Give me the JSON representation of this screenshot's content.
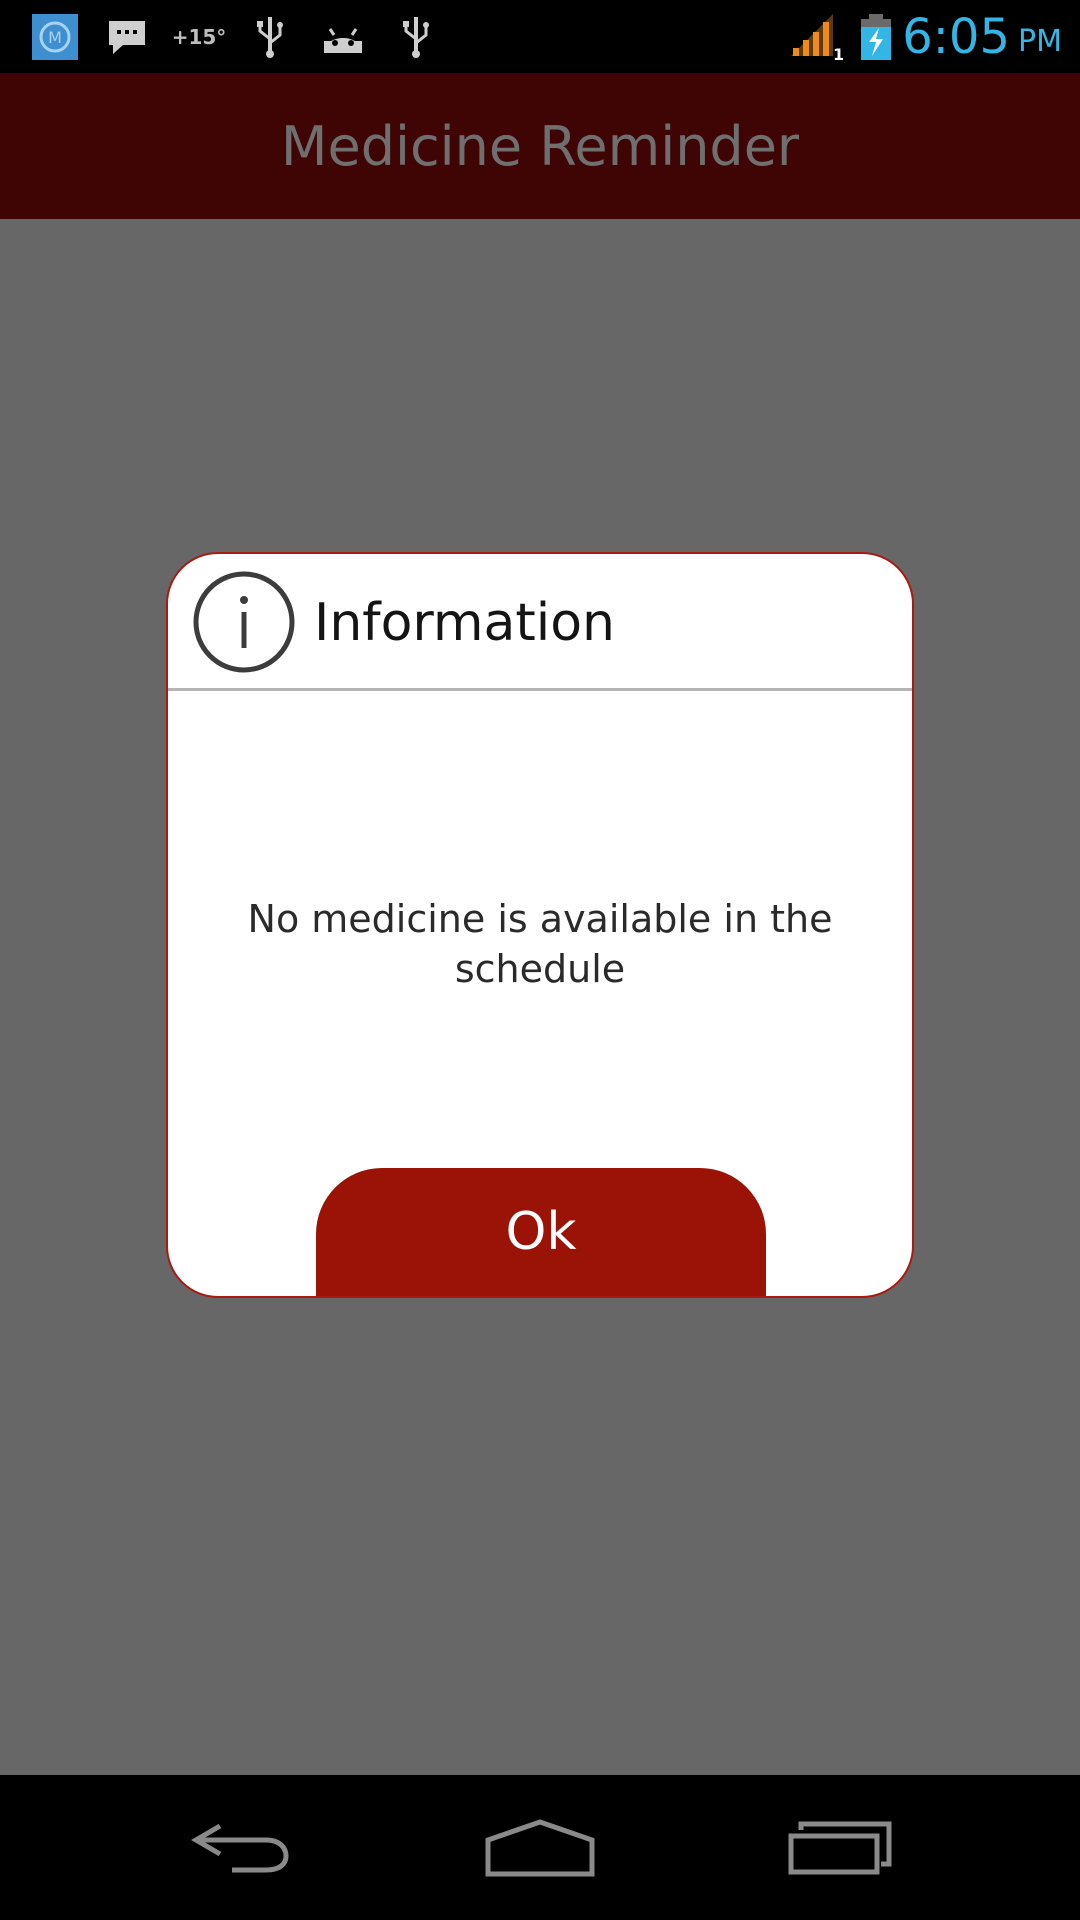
{
  "status_bar": {
    "temperature": "+15°",
    "time": "6:05",
    "ampm": "PM",
    "signal_sim": "1",
    "icons": [
      "m-app-icon",
      "message-icon",
      "temperature-icon",
      "usb-icon",
      "android-debug-icon",
      "usb-icon",
      "signal-icon",
      "battery-charging-icon"
    ]
  },
  "app_bar": {
    "title": "Medicine Reminder"
  },
  "dialog": {
    "icon": "info-icon",
    "title": "Information",
    "message": "No medicine is available in the schedule",
    "ok_label": "Ok"
  },
  "nav_bar": {
    "buttons": [
      "back-icon",
      "home-icon",
      "recents-icon"
    ]
  },
  "colors": {
    "app_bar": "#3f0404",
    "scrim": "#676767",
    "dialog_border": "#a91b12",
    "button": "#9b1306",
    "clock": "#33b5e5"
  }
}
